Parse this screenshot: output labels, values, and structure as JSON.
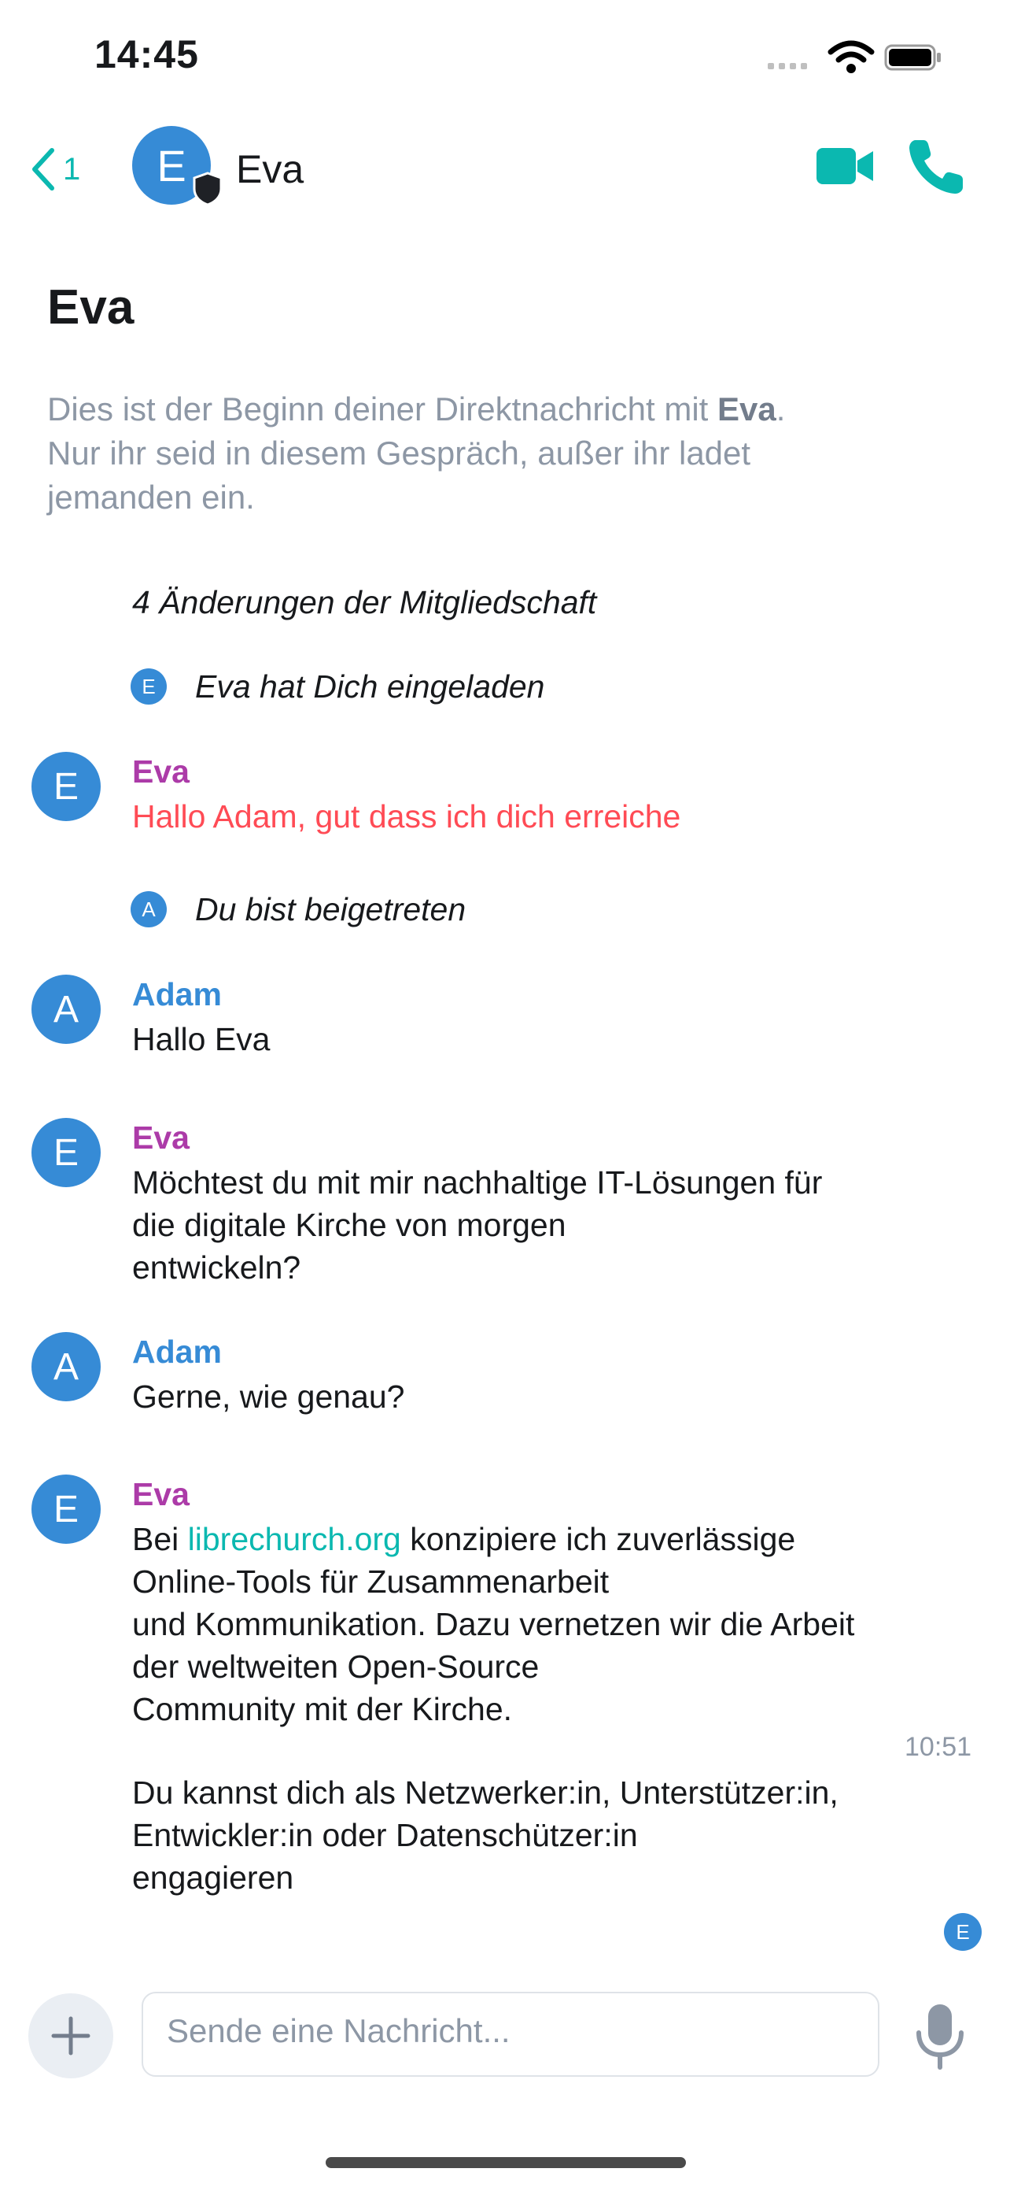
{
  "status_bar": {
    "time": "14:45"
  },
  "header": {
    "back_count": "1",
    "avatar_letter": "E",
    "name": "Eva"
  },
  "room": {
    "title": "Eva",
    "intro_prefix": "Dies ist der Beginn deiner Direktnachricht mit ",
    "intro_name": "Eva",
    "intro_suffix": ".",
    "intro_line2": "Nur ihr seid in diesem Gespräch, außer ihr ladet",
    "intro_line3": "jemanden ein."
  },
  "membership": {
    "summary": "4 Änderungen der Mitgliedschaft",
    "event1_avatar": "E",
    "event1_text": "Eva hat Dich eingeladen",
    "event2_avatar": "A",
    "event2_text": "Du bist beigetreten"
  },
  "messages": [
    {
      "avatar": "E",
      "sender": "Eva",
      "lines": [
        "Hallo Adam, gut dass ich dich erreiche"
      ]
    },
    {
      "avatar": "A",
      "sender": "Adam",
      "lines": [
        "Hallo Eva"
      ]
    },
    {
      "avatar": "E",
      "sender": "Eva",
      "lines": [
        "Möchtest du mit mir nachhaltige IT-Lösungen für",
        "die digitale Kirche von morgen",
        "entwickeln?"
      ]
    },
    {
      "avatar": "A",
      "sender": "Adam",
      "lines": [
        "Gerne, wie genau?"
      ]
    },
    {
      "avatar": "E",
      "sender": "Eva",
      "line1_prefix": "Bei ",
      "link": "librechurch.org",
      "line1_suffix": " konzipiere ich zuverlässige",
      "lines": [
        "Online-Tools für Zusammenarbeit",
        "und Kommunikation. Dazu vernetzen wir die Arbeit",
        "der weltweiten Open-Source",
        "Community mit der Kirche."
      ],
      "lines_after": [
        "Du kannst dich als Netzwerker:in, Unterstützer:in,",
        "Entwickler:in oder Datenschützer:in",
        "engagieren"
      ]
    }
  ],
  "timestamp": "10:51",
  "read_receipt": "E",
  "composer": {
    "placeholder": "Sende eine Nachricht..."
  },
  "colors": {
    "accent": "#0bb8b0",
    "avatar_blue": "#368bd6",
    "eva_name": "#ac3ba8",
    "adam_name": "#368bd6",
    "highlight_red": "#ff4b55"
  },
  "icons": {
    "back": "chevron-left-icon",
    "shield": "shield-icon",
    "video": "video-camera-icon",
    "call": "phone-icon",
    "plus": "plus-icon",
    "mic": "microphone-icon"
  }
}
